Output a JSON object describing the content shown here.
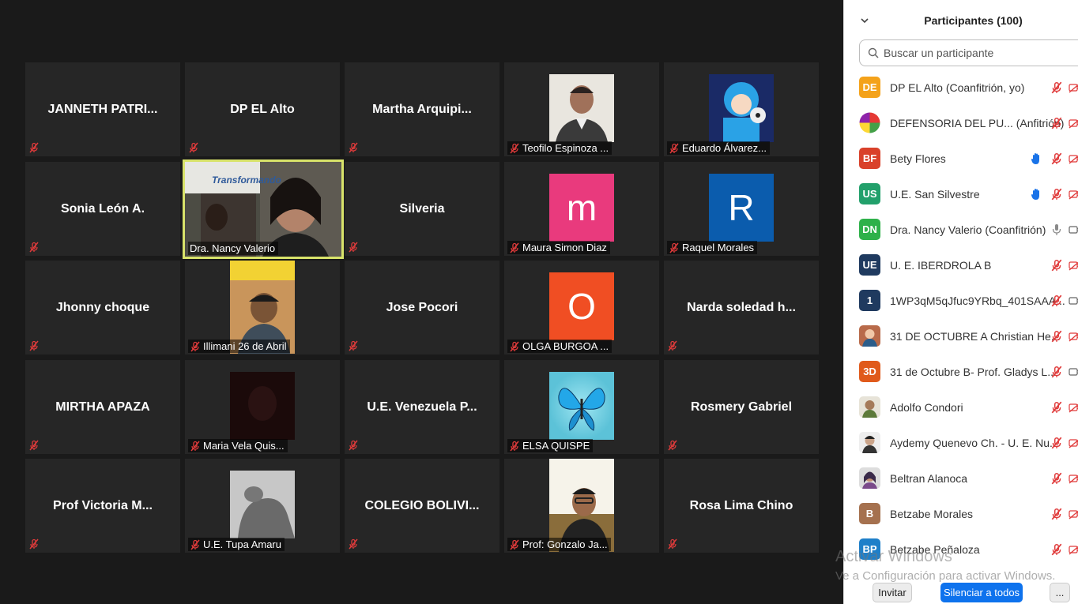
{
  "gallery": {
    "tiles": [
      {
        "name": "JANNETH PATRI...",
        "type": "text"
      },
      {
        "name": "DP EL Alto",
        "type": "text"
      },
      {
        "name": "Martha  Arquipi...",
        "type": "text"
      },
      {
        "name": "Teofilo Espinoza ...",
        "type": "photo"
      },
      {
        "name": "Eduardo Álvarez...",
        "type": "photo"
      },
      {
        "name": "Sonia León A.",
        "type": "text"
      },
      {
        "name": "Dra. Nancy Valerio",
        "type": "video"
      },
      {
        "name": "Silveria",
        "type": "text"
      },
      {
        "name": "Maura Simon Diaz",
        "type": "letter",
        "letter": "m",
        "color": "#e93a7d"
      },
      {
        "name": "Raquel Morales",
        "type": "letter",
        "letter": "R",
        "color": "#0b5cad"
      },
      {
        "name": "Jhonny  choque",
        "type": "text"
      },
      {
        "name": "Illimani 26 de Abril",
        "type": "photo"
      },
      {
        "name": "Jose Pocori",
        "type": "text"
      },
      {
        "name": "OLGA BURGOA  ...",
        "type": "letter",
        "letter": "O",
        "color": "#f04e23"
      },
      {
        "name": "Narda soledad h...",
        "type": "text"
      },
      {
        "name": "MIRTHA APAZA",
        "type": "text"
      },
      {
        "name": "Maria Vela Quis...",
        "type": "photo"
      },
      {
        "name": "U.E.  Venezuela  P...",
        "type": "text"
      },
      {
        "name": "ELSA QUISPE",
        "type": "photo"
      },
      {
        "name": "Rosmery Gabriel",
        "type": "text"
      },
      {
        "name": "Prof Victoria  M...",
        "type": "text"
      },
      {
        "name": "U.E. Tupa Amaru",
        "type": "photo"
      },
      {
        "name": "COLEGIO  BOLIVI...",
        "type": "text"
      },
      {
        "name": "Prof: Gonzalo Ja...",
        "type": "photo"
      },
      {
        "name": "Rosa Lima Chino",
        "type": "text"
      }
    ],
    "video_banner_text": "Transformando"
  },
  "panel": {
    "title": "Participantes (100)",
    "search_placeholder": "Buscar un participante",
    "participants": [
      {
        "initials": "DE",
        "color": "#f4a21a",
        "name": "DP EL Alto (Coanfitrión, yo)",
        "hand": false,
        "mic": "muted",
        "cam": "off"
      },
      {
        "initials": "",
        "color": "#888888",
        "name": "DEFENSORIA DEL PU...  (Anfitrión)",
        "hand": false,
        "mic": "muted",
        "cam": "off"
      },
      {
        "initials": "BF",
        "color": "#d9412a",
        "name": "Bety Flores",
        "hand": true,
        "mic": "muted",
        "cam": "off"
      },
      {
        "initials": "US",
        "color": "#22a06b",
        "name": "U.E. San Silvestre",
        "hand": true,
        "mic": "muted",
        "cam": "off"
      },
      {
        "initials": "DN",
        "color": "#2eb14a",
        "name": "Dra. Nancy Valerio (Coanfitrión)",
        "hand": false,
        "mic": "on",
        "cam": "on"
      },
      {
        "initials": "UE",
        "color": "#1f3a5f",
        "name": " U. E. IBERDROLA B",
        "hand": false,
        "mic": "muted",
        "cam": "off"
      },
      {
        "initials": "1",
        "color": "#1f3a5f",
        "name": "1WP3qM5qJfuc9YRbq_401SAAA...",
        "hand": false,
        "mic": "muted",
        "cam": "on"
      },
      {
        "initials": "",
        "color": "#a0522d",
        "name": "31 DE OCTUBRE A Christian He...",
        "hand": false,
        "mic": "muted",
        "cam": "off"
      },
      {
        "initials": "3D",
        "color": "#e05a1b",
        "name": "31 de Octubre B- Prof. Gladys L...",
        "hand": false,
        "mic": "muted",
        "cam": "on"
      },
      {
        "initials": "",
        "color": "#7a8a6a",
        "name": "Adolfo Condori",
        "hand": false,
        "mic": "muted",
        "cam": "off"
      },
      {
        "initials": "",
        "color": "#554444",
        "name": "Aydemy Quenevo Ch. - U. E. Nu...",
        "hand": false,
        "mic": "muted",
        "cam": "off"
      },
      {
        "initials": "",
        "color": "#6a4a7a",
        "name": "Beltran Alanoca",
        "hand": false,
        "mic": "muted",
        "cam": "off"
      },
      {
        "initials": "B",
        "color": "#a5714f",
        "name": "Betzabe Morales",
        "hand": false,
        "mic": "muted",
        "cam": "off"
      },
      {
        "initials": "BP",
        "color": "#1e7fc9",
        "name": "Betzabe Peñaloza",
        "hand": false,
        "mic": "muted",
        "cam": "off"
      }
    ],
    "invite_label": "Invitar",
    "mute_all_label": "Silenciar a todos",
    "more_label": "..."
  },
  "watermark": {
    "line1": "Activar Windows",
    "line2": "Ve a Configuración para activar Windows."
  }
}
